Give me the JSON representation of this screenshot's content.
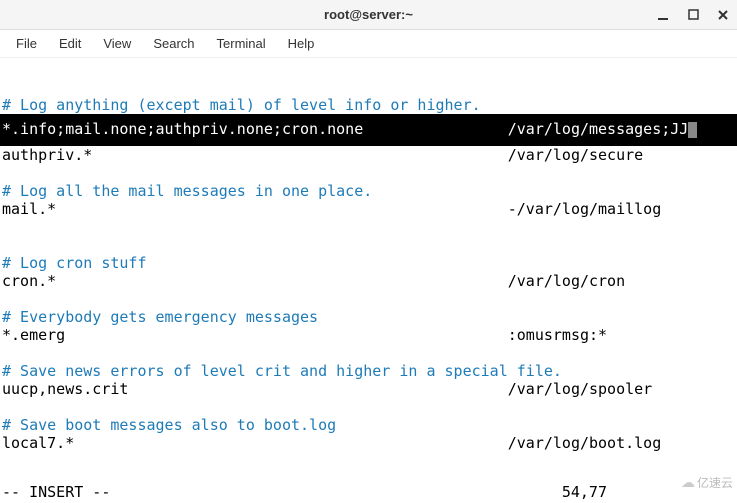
{
  "window": {
    "title": "root@server:~"
  },
  "menu": {
    "file": "File",
    "edit": "Edit",
    "view": "View",
    "search": "Search",
    "terminal": "Terminal",
    "help": "Help"
  },
  "editor": {
    "lines": {
      "c1": "# Log anything (except mail) of level info or higher.",
      "highlighted": "*.info;mail.none;authpriv.none;cron.none                /var/log/messages;JJ",
      "l_authpriv": "authpriv.*                                              /var/log/secure",
      "c2": "# Log all the mail messages in one place.",
      "l_mail": "mail.*                                                  -/var/log/maillog",
      "c3": "# Log cron stuff",
      "l_cron": "cron.*                                                  /var/log/cron",
      "c4": "# Everybody gets emergency messages",
      "l_emerg": "*.emerg                                                 :omusrmsg:*",
      "c5": "# Save news errors of level crit and higher in a special file.",
      "l_uucp": "uucp,news.crit                                          /var/log/spooler",
      "c6": "# Save boot messages also to boot.log",
      "l_local7": "local7.*                                                /var/log/boot.log"
    },
    "mode": "-- INSERT --",
    "position": "54,77"
  },
  "watermark": "亿速云"
}
